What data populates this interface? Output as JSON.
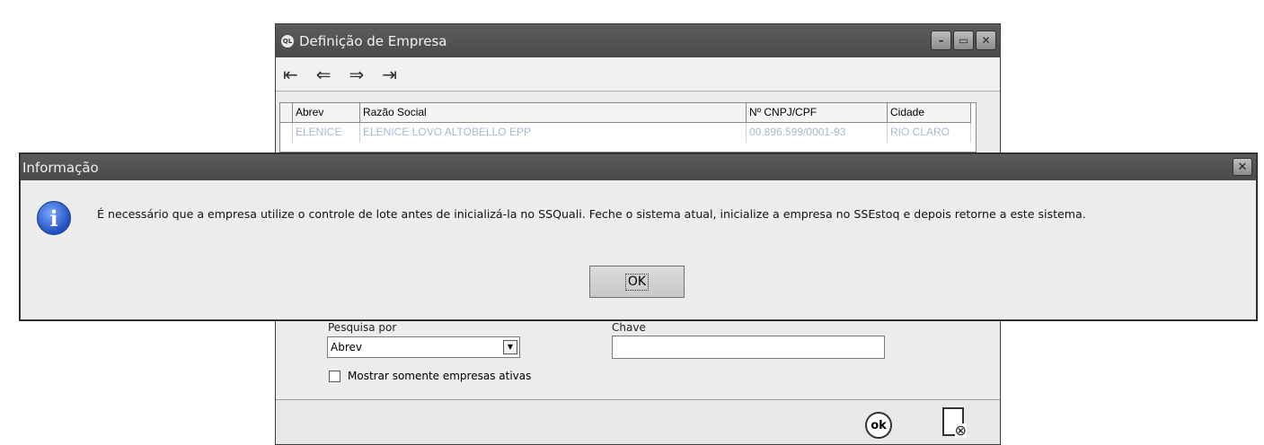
{
  "window": {
    "app_icon": "QL",
    "title": "Definição de Empresa",
    "controls": {
      "minimize": "–",
      "maximize": "▭",
      "close": "✕"
    }
  },
  "nav": {
    "first": "⇤",
    "prev": "⇐",
    "next": "⇒",
    "last": "⇥"
  },
  "grid": {
    "columns": [
      "Abrev",
      "Razão Social",
      "Nº CNPJ/CPF",
      "Cidade"
    ],
    "rows": [
      [
        "ELENICE",
        "ELENICE LOVO ALTOBELLO EPP",
        "00.896.599/0001-93",
        "RIO CLARO"
      ]
    ],
    "row_color": "#a9b8d4"
  },
  "search": {
    "by_label": "Pesquisa por",
    "by_value": "Abrev",
    "key_label": "Chave",
    "key_value": ""
  },
  "checkbox_label": "Mostrar somente empresas ativas",
  "footer": {
    "ok_icon": "ok"
  },
  "dialog": {
    "title": "Informação",
    "close": "✕",
    "icon": "i",
    "message": "É necessário que a empresa utilize o controle de lote antes de inicializá-la no SSQuali. Feche o sistema atual, inicialize a empresa no SSEstoq e depois retorne a este sistema.",
    "ok_label": "OK"
  }
}
